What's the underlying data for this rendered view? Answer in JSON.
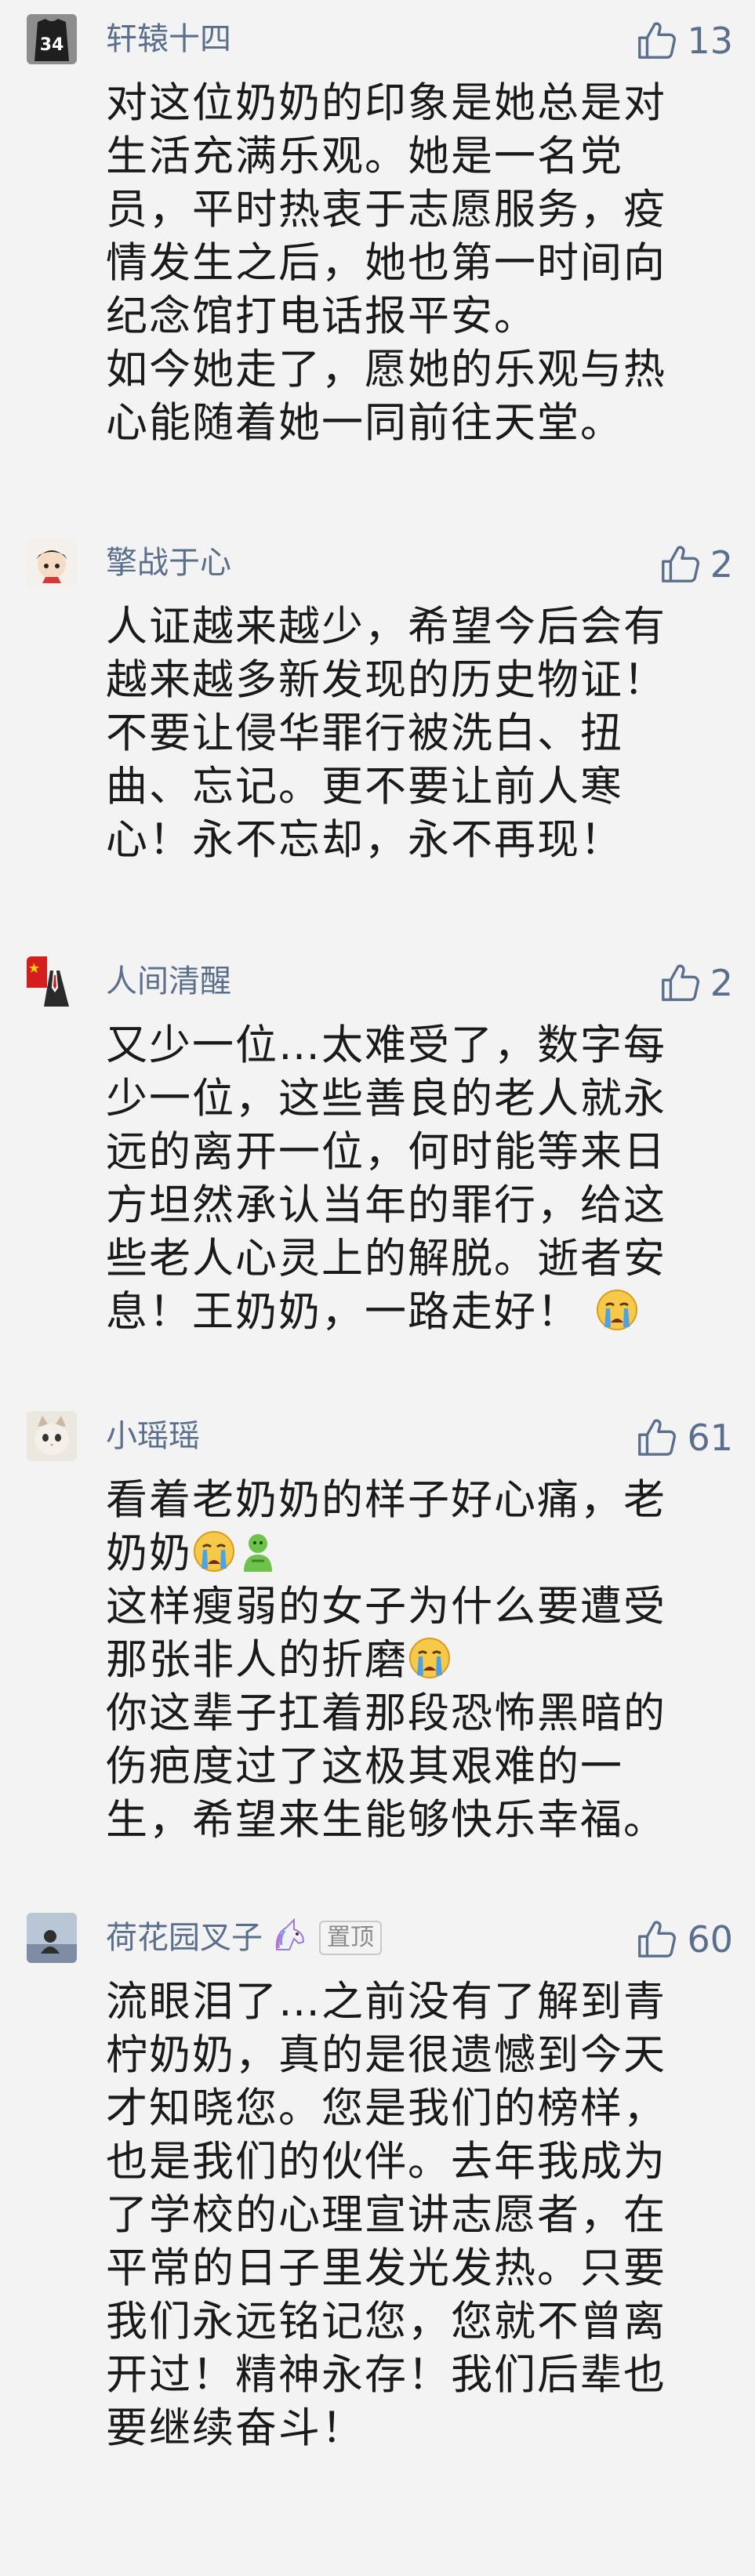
{
  "comments": [
    {
      "username": "轩辕十四",
      "likes": "13",
      "avatar_icon": "jersey-34-avatar",
      "lines": [
        "对这位奶奶的印象是她总是对",
        "生活充满乐观。她是一名党",
        "员，平时热衷于志愿服务，疫",
        "情发生之后，她也第一时间向",
        "纪念馆打电话报平安。",
        "如今她走了，愿她的乐观与热",
        "心能随着她一同前往天堂。"
      ]
    },
    {
      "username": "擎战于心",
      "likes": "2",
      "avatar_icon": "cartoon-character-avatar",
      "lines": [
        "人证越来越少，希望今后会有",
        "越来越多新发现的历史物证！",
        "不要让侵华罪行被洗白、扭",
        "曲、忘记。更不要让前人寒",
        "心！永不忘却，永不再现！"
      ]
    },
    {
      "username": "人间清醒",
      "likes": "2",
      "avatar_icon": "flag-suit-avatar",
      "lines": [
        "又少一位…太难受了，数字每",
        "少一位，这些善良的老人就永",
        "远的离开一位，何时能等来日",
        "方坦然承认当年的罪行，给这",
        "些老人心灵上的解脱。逝者安",
        "息！王奶奶，一路走好！"
      ]
    },
    {
      "username": "小瑶瑶",
      "likes": "61",
      "avatar_icon": "kitten-avatar",
      "lines": [
        "看着老奶奶的样子好心痛，老",
        "奶奶",
        "这样瘦弱的女子为什么要遭受",
        "那张非人的折磨",
        "你这辈子扛着那段恐怖黑暗的",
        "伤疤度过了这极其艰难的一",
        "生，希望来生能够快乐幸福。"
      ]
    },
    {
      "username": "荷花园叉子",
      "likes": "60",
      "pinned_label": "置顶",
      "avatar_icon": "landscape-avatar",
      "lines": [
        "流眼泪了…之前没有了解到青",
        "柠奶奶，真的是很遗憾到今天",
        "才知晓您。您是我们的榜样，",
        "也是我们的伙伴。去年我成为",
        "了学校的心理宣讲志愿者，在",
        "平常的日子里发光发热。只要",
        "我们永远铭记您，您就不曾离",
        "开过！精神永存！我们后辈也",
        "要继续奋斗！"
      ]
    }
  ],
  "colors": {
    "background": "#f3f3f3",
    "username": "#5a6f8c",
    "text": "#1a1a1a"
  }
}
